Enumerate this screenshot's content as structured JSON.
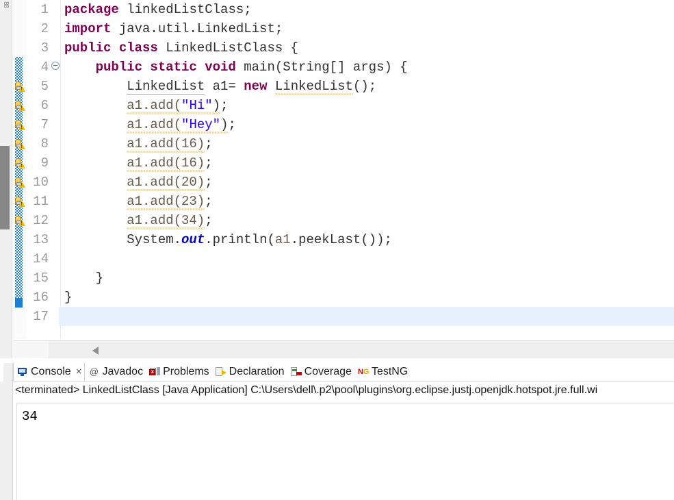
{
  "window": {
    "fastview_label": "88"
  },
  "editor": {
    "current_line": 17,
    "lines": [
      {
        "num": "1",
        "segments": [
          {
            "t": "package",
            "c": "kw"
          },
          {
            "t": " linkedListClass;",
            "c": "plain"
          }
        ]
      },
      {
        "num": "2",
        "segments": [
          {
            "t": "import",
            "c": "kw"
          },
          {
            "t": " java.util.LinkedList;",
            "c": "plain"
          }
        ]
      },
      {
        "num": "3",
        "segments": [
          {
            "t": "public class",
            "c": "kw"
          },
          {
            "t": " LinkedListClass {",
            "c": "plain"
          }
        ]
      },
      {
        "num": "4",
        "segments": [
          {
            "t": "    ",
            "c": "plain"
          },
          {
            "t": "public static void",
            "c": "kw"
          },
          {
            "t": " main(String[] args) {",
            "c": "plain"
          }
        ]
      },
      {
        "num": "5",
        "segments": [
          {
            "t": "        ",
            "c": "plain"
          },
          {
            "t": "LinkedList",
            "c": "plain ul"
          },
          {
            "t": " a1= ",
            "c": "plain"
          },
          {
            "t": "new",
            "c": "kw"
          },
          {
            "t": " ",
            "c": "plain"
          },
          {
            "t": "LinkedList",
            "c": "plain sq"
          },
          {
            "t": "();",
            "c": "plain"
          }
        ]
      },
      {
        "num": "6",
        "segments": [
          {
            "t": "        ",
            "c": "plain"
          },
          {
            "t": "a1.add(",
            "c": "loc sq"
          },
          {
            "t": "\"Hi\"",
            "c": "str sq"
          },
          {
            "t": ")",
            "c": "plain sq"
          },
          {
            "t": ";",
            "c": "plain"
          }
        ]
      },
      {
        "num": "7",
        "segments": [
          {
            "t": "        ",
            "c": "plain"
          },
          {
            "t": "a1.add(",
            "c": "loc sq"
          },
          {
            "t": "\"Hey\"",
            "c": "str sq"
          },
          {
            "t": ")",
            "c": "plain sq"
          },
          {
            "t": ";",
            "c": "plain"
          }
        ]
      },
      {
        "num": "8",
        "segments": [
          {
            "t": "        ",
            "c": "plain"
          },
          {
            "t": "a1.add(16)",
            "c": "loc sq"
          },
          {
            "t": ";",
            "c": "plain"
          }
        ]
      },
      {
        "num": "9",
        "segments": [
          {
            "t": "        ",
            "c": "plain"
          },
          {
            "t": "a1.add(16)",
            "c": "loc sq"
          },
          {
            "t": ";",
            "c": "plain"
          }
        ]
      },
      {
        "num": "10",
        "segments": [
          {
            "t": "        ",
            "c": "plain"
          },
          {
            "t": "a1.add(20)",
            "c": "loc sq"
          },
          {
            "t": ";",
            "c": "plain"
          }
        ]
      },
      {
        "num": "11",
        "segments": [
          {
            "t": "        ",
            "c": "plain"
          },
          {
            "t": "a1.add(23)",
            "c": "loc sq"
          },
          {
            "t": ";",
            "c": "plain"
          }
        ]
      },
      {
        "num": "12",
        "segments": [
          {
            "t": "        ",
            "c": "plain"
          },
          {
            "t": "a1.add(34)",
            "c": "loc sq"
          },
          {
            "t": ";",
            "c": "plain"
          }
        ]
      },
      {
        "num": "13",
        "segments": [
          {
            "t": "        System.",
            "c": "plain"
          },
          {
            "t": "out",
            "c": "fld"
          },
          {
            "t": ".println(",
            "c": "plain"
          },
          {
            "t": "a1",
            "c": "loc"
          },
          {
            "t": ".peekLast());",
            "c": "plain"
          }
        ]
      },
      {
        "num": "14",
        "segments": [
          {
            "t": "",
            "c": "plain"
          }
        ]
      },
      {
        "num": "15",
        "segments": [
          {
            "t": "    }",
            "c": "plain"
          }
        ]
      },
      {
        "num": "16",
        "segments": [
          {
            "t": "}",
            "c": "plain"
          }
        ]
      },
      {
        "num": "17",
        "segments": [
          {
            "t": "",
            "c": "plain"
          }
        ]
      }
    ],
    "warning_lines": [
      5,
      6,
      7,
      8,
      9,
      10,
      11,
      12
    ],
    "fold_marker_line": 4
  },
  "bottom_panel": {
    "tabs": [
      {
        "label": "Console",
        "icon": "console-icon",
        "active": true,
        "closable": true,
        "close_glyph": "×"
      },
      {
        "label": "Javadoc",
        "icon": "javadoc-at-icon",
        "active": false,
        "closable": false
      },
      {
        "label": "Problems",
        "icon": "problems-icon",
        "active": false,
        "closable": false
      },
      {
        "label": "Declaration",
        "icon": "declaration-icon",
        "active": false,
        "closable": false
      },
      {
        "label": "Coverage",
        "icon": "coverage-icon",
        "active": false,
        "closable": false
      },
      {
        "label": "TestNG",
        "icon": "testng-icon",
        "active": false,
        "closable": false
      }
    ],
    "javadoc_glyph": "@",
    "testng_glyph_n": "N",
    "testng_glyph_g": "G",
    "launch_status": "<terminated> LinkedListClass [Java Application] C:\\Users\\dell\\.p2\\pool\\plugins\\org.eclipse.justj.openjdk.hotspot.jre.full.wi",
    "console_output": "34"
  },
  "colors": {
    "keyword": "#7f0055",
    "string": "#2a00ff",
    "static_field": "#0000c0",
    "local_var": "#6a5a4a",
    "warning_squiggle": "#d4a017",
    "change_bar": "#1f7fd0",
    "current_line_highlight": "#e8f2fe"
  }
}
